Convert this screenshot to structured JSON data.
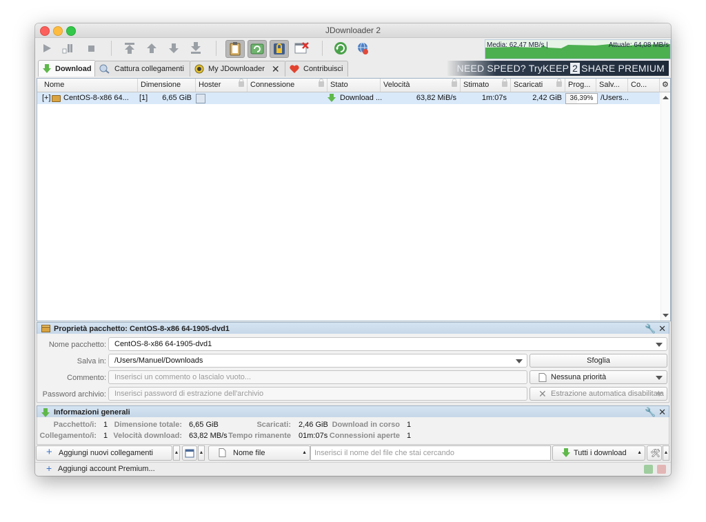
{
  "window": {
    "title": "JDownloader 2"
  },
  "speed": {
    "average": "Media: 62,47 MB/s |",
    "current": "Attuale: 64,08 MB/s"
  },
  "tabs": [
    {
      "label": "Download",
      "active": true
    },
    {
      "label": "Cattura collegamenti",
      "active": false
    },
    {
      "label": "My JDownloader",
      "active": false
    },
    {
      "label": "Contribuisci",
      "active": false
    }
  ],
  "banner": {
    "pre": "NEED SPEED? Try ",
    "keep": "KEEP",
    "num": "2",
    "share": "SHARE PREMIUM"
  },
  "table": {
    "columns": [
      "Nome",
      "Dimensione",
      "Hoster",
      "Connessione",
      "Stato",
      "Velocità",
      "Stimato",
      "Scaricati",
      "Prog...",
      "Salv...",
      "Co..."
    ],
    "rows": [
      {
        "expander": "[+]",
        "name": "CentOS-8-x86 64...",
        "count": "[1]",
        "size": "6,65 GiB",
        "status": "Download ...",
        "speed": "63,82 MiB/s",
        "eta": "1m:07s",
        "downloaded": "2,42 GiB",
        "progress": "36,39%",
        "progress_value": 0.3639,
        "save_to": "/Users..."
      }
    ]
  },
  "properties": {
    "title": "Proprietà pacchetto: CentOS-8-x86 64-1905-dvd1",
    "package_name_label": "Nome pacchetto:",
    "package_name": "CentOS-8-x86 64-1905-dvd1",
    "save_in_label": "Salva in:",
    "save_in": "/Users/Manuel/Downloads",
    "browse": "Sfoglia",
    "comment_label": "Commento:",
    "comment_placeholder": "Inserisci un commento o lascialo vuoto...",
    "priority": "Nessuna priorità",
    "password_label": "Password archivio:",
    "password_placeholder": "Inserisci password di estrazione dell'archivio",
    "auto_extract": "Estrazione automatica disabilitata"
  },
  "info": {
    "title": "Informazioni generali",
    "packages_label": "Pacchetto/i:",
    "packages": "1",
    "links_label": "Collegamento/i:",
    "links": "1",
    "total_size_label": "Dimensione totale:",
    "total_size": "6,65 GiB",
    "dl_speed_label": "Velocità download:",
    "dl_speed": "63,82 MB/s",
    "downloaded_label": "Scaricati:",
    "downloaded": "2,46 GiB",
    "remaining_label": "Tempo rimanente",
    "remaining": "01m:07s",
    "running_label": "Download in corso",
    "running": "1",
    "open_conn_label": "Connessioni aperte",
    "open_conn": "1"
  },
  "bottombar": {
    "add_links": "Aggiungi nuovi collegamenti web...",
    "filter_by": "Nome file",
    "search_placeholder": "Inserisci il nome del file che stai cercando",
    "view": "Tutti i download"
  },
  "statusbar": {
    "add_premium": "Aggiungi account Premium..."
  }
}
